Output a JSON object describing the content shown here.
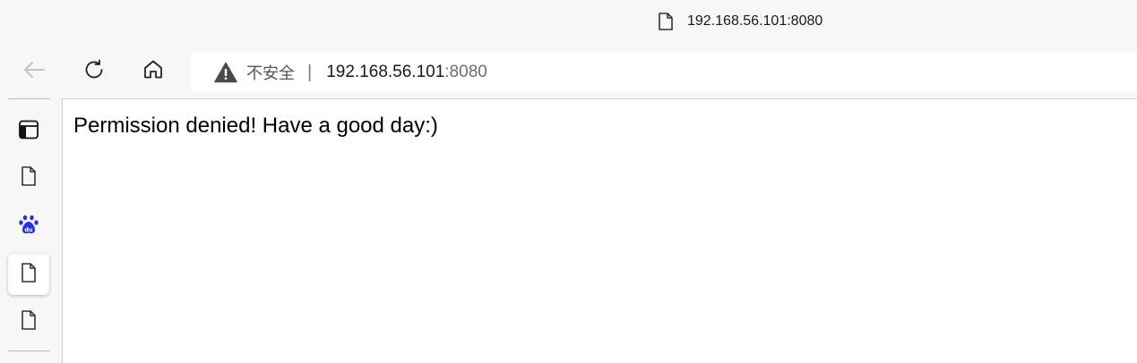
{
  "window": {
    "title": "192.168.56.101:8080"
  },
  "toolbar": {
    "security_label": "不安全",
    "separator": "|",
    "url_host": "192.168.56.101",
    "url_port": ":8080"
  },
  "sidebar": {
    "items": [
      {
        "icon": "workspaces-icon"
      },
      {
        "icon": "page-icon"
      },
      {
        "icon": "baidu-paw-icon",
        "text": "du"
      },
      {
        "icon": "page-icon",
        "active": true
      },
      {
        "icon": "page-icon"
      }
    ]
  },
  "page": {
    "message": "Permission denied! Have a good day:)"
  },
  "colors": {
    "chrome_bg": "#f7f7f7",
    "baidu_blue": "#2932e1",
    "text": "#1a1a1a"
  }
}
